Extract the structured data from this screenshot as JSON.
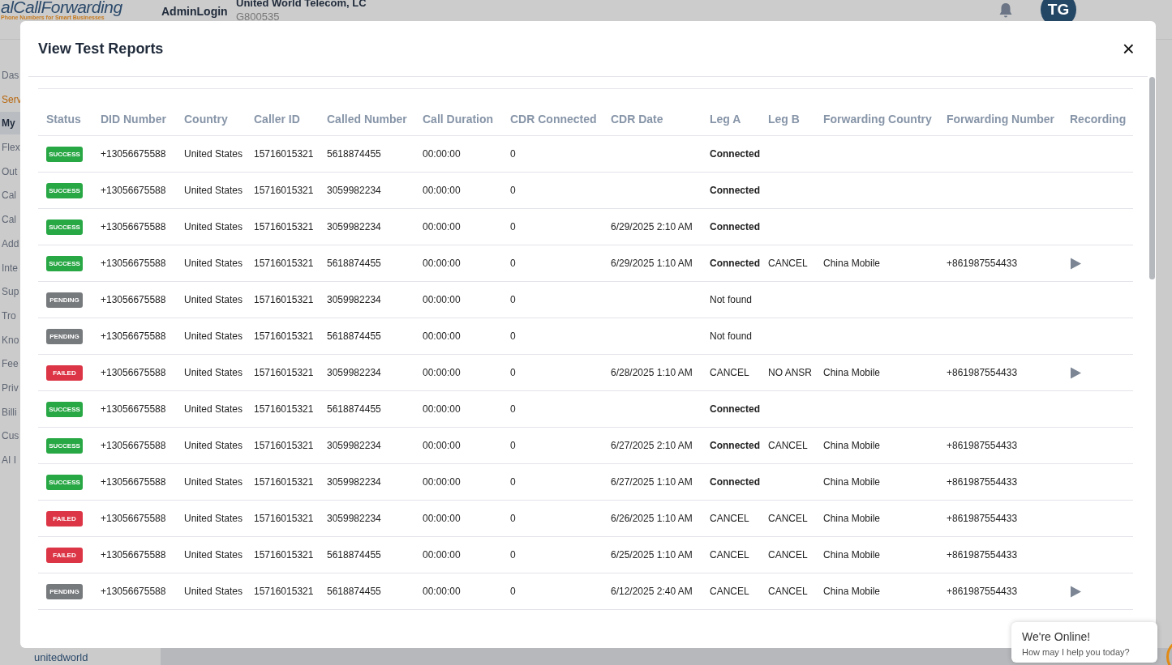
{
  "header": {
    "logo": "alCallForwarding",
    "tagline": "Phone Numbers for Smart Businesses",
    "user_label": "AdminLogin",
    "company": "United World Telecom, LC",
    "account": "G800535",
    "avatar": "TG"
  },
  "sidebar": {
    "items": [
      {
        "label": "Das",
        "kind": "item",
        "selected": false
      },
      {
        "label": "Serv",
        "kind": "section",
        "selected": false
      },
      {
        "label": "My",
        "kind": "item",
        "selected": true
      },
      {
        "label": "Flex",
        "kind": "item",
        "selected": false
      },
      {
        "label": "Out",
        "kind": "item",
        "selected": false
      },
      {
        "label": "Cal",
        "kind": "item",
        "selected": false
      },
      {
        "label": "Cal",
        "kind": "item",
        "selected": false
      },
      {
        "label": "Add",
        "kind": "item",
        "selected": false
      },
      {
        "label": "Inte",
        "kind": "item",
        "selected": false
      },
      {
        "label": "Sup",
        "kind": "item",
        "selected": false
      },
      {
        "label": "Tro",
        "kind": "item",
        "selected": false
      },
      {
        "label": "Kno",
        "kind": "item",
        "selected": false
      },
      {
        "label": "Fee",
        "kind": "item",
        "selected": false
      },
      {
        "label": "Priv",
        "kind": "item",
        "selected": false
      },
      {
        "label": "Billi",
        "kind": "item",
        "selected": false
      },
      {
        "label": "Cus",
        "kind": "item",
        "selected": false
      },
      {
        "label": "AI I",
        "kind": "item",
        "selected": false
      }
    ],
    "footer_logo": "unitedworld"
  },
  "modal": {
    "title": "View Test Reports",
    "close": "×",
    "table": {
      "columns": [
        "Status",
        "DID Number",
        "Country",
        "Caller ID",
        "Called Number",
        "Call Duration",
        "CDR Connected",
        "CDR Date",
        "Leg A",
        "Leg B",
        "Forwarding Country",
        "Forwarding Number",
        "Recording"
      ],
      "rows": [
        {
          "status": {
            "label": "SUCCESS",
            "kind": "success"
          },
          "did": "+13056675588",
          "country": "United States",
          "caller_id": "15716015321",
          "called": "5618874455",
          "duration": "00:00:00",
          "cdr_connected": "0",
          "cdr_date": "",
          "leg_a": {
            "text": "Connected",
            "emphasis": true
          },
          "leg_b": "",
          "fwd_country": "",
          "fwd_number": "",
          "recording": false
        },
        {
          "status": {
            "label": "SUCCESS",
            "kind": "success"
          },
          "did": "+13056675588",
          "country": "United States",
          "caller_id": "15716015321",
          "called": "3059982234",
          "duration": "00:00:00",
          "cdr_connected": "0",
          "cdr_date": "",
          "leg_a": {
            "text": "Connected",
            "emphasis": true
          },
          "leg_b": "",
          "fwd_country": "",
          "fwd_number": "",
          "recording": false
        },
        {
          "status": {
            "label": "SUCCESS",
            "kind": "success"
          },
          "did": "+13056675588",
          "country": "United States",
          "caller_id": "15716015321",
          "called": "3059982234",
          "duration": "00:00:00",
          "cdr_connected": "0",
          "cdr_date": "6/29/2025 2:10 AM",
          "leg_a": {
            "text": "Connected",
            "emphasis": true
          },
          "leg_b": "",
          "fwd_country": "",
          "fwd_number": "",
          "recording": false
        },
        {
          "status": {
            "label": "SUCCESS",
            "kind": "success"
          },
          "did": "+13056675588",
          "country": "United States",
          "caller_id": "15716015321",
          "called": "5618874455",
          "duration": "00:00:00",
          "cdr_connected": "0",
          "cdr_date": "6/29/2025 1:10 AM",
          "leg_a": {
            "text": "Connected",
            "emphasis": true
          },
          "leg_b": "CANCEL",
          "fwd_country": "China Mobile",
          "fwd_number": "+861987554433",
          "recording": true
        },
        {
          "status": {
            "label": "PENDING",
            "kind": "pending"
          },
          "did": "+13056675588",
          "country": "United States",
          "caller_id": "15716015321",
          "called": "3059982234",
          "duration": "00:00:00",
          "cdr_connected": "0",
          "cdr_date": "",
          "leg_a": {
            "text": "Not found",
            "emphasis": false
          },
          "leg_b": "",
          "fwd_country": "",
          "fwd_number": "",
          "recording": false
        },
        {
          "status": {
            "label": "PENDING",
            "kind": "pending"
          },
          "did": "+13056675588",
          "country": "United States",
          "caller_id": "15716015321",
          "called": "5618874455",
          "duration": "00:00:00",
          "cdr_connected": "0",
          "cdr_date": "",
          "leg_a": {
            "text": "Not found",
            "emphasis": false
          },
          "leg_b": "",
          "fwd_country": "",
          "fwd_number": "",
          "recording": false
        },
        {
          "status": {
            "label": "FAILED",
            "kind": "failed"
          },
          "did": "+13056675588",
          "country": "United States",
          "caller_id": "15716015321",
          "called": "3059982234",
          "duration": "00:00:00",
          "cdr_connected": "0",
          "cdr_date": "6/28/2025 1:10 AM",
          "leg_a": {
            "text": "CANCEL",
            "emphasis": false
          },
          "leg_b": "NO ANSR",
          "fwd_country": "China Mobile",
          "fwd_number": "+861987554433",
          "recording": true
        },
        {
          "status": {
            "label": "SUCCESS",
            "kind": "success"
          },
          "did": "+13056675588",
          "country": "United States",
          "caller_id": "15716015321",
          "called": "5618874455",
          "duration": "00:00:00",
          "cdr_connected": "0",
          "cdr_date": "",
          "leg_a": {
            "text": "Connected",
            "emphasis": true
          },
          "leg_b": "",
          "fwd_country": "",
          "fwd_number": "",
          "recording": false
        },
        {
          "status": {
            "label": "SUCCESS",
            "kind": "success"
          },
          "did": "+13056675588",
          "country": "United States",
          "caller_id": "15716015321",
          "called": "3059982234",
          "duration": "00:00:00",
          "cdr_connected": "0",
          "cdr_date": "6/27/2025 2:10 AM",
          "leg_a": {
            "text": "Connected",
            "emphasis": true
          },
          "leg_b": "CANCEL",
          "fwd_country": "China Mobile",
          "fwd_number": "+861987554433",
          "recording": false
        },
        {
          "status": {
            "label": "SUCCESS",
            "kind": "success"
          },
          "did": "+13056675588",
          "country": "United States",
          "caller_id": "15716015321",
          "called": "3059982234",
          "duration": "00:00:00",
          "cdr_connected": "0",
          "cdr_date": "6/27/2025 1:10 AM",
          "leg_a": {
            "text": "Connected",
            "emphasis": true
          },
          "leg_b": "",
          "fwd_country": "China Mobile",
          "fwd_number": "+861987554433",
          "recording": false
        },
        {
          "status": {
            "label": "FAILED",
            "kind": "failed"
          },
          "did": "+13056675588",
          "country": "United States",
          "caller_id": "15716015321",
          "called": "3059982234",
          "duration": "00:00:00",
          "cdr_connected": "0",
          "cdr_date": "6/26/2025 1:10 AM",
          "leg_a": {
            "text": "CANCEL",
            "emphasis": false
          },
          "leg_b": "CANCEL",
          "fwd_country": "China Mobile",
          "fwd_number": "+861987554433",
          "recording": false
        },
        {
          "status": {
            "label": "FAILED",
            "kind": "failed"
          },
          "did": "+13056675588",
          "country": "United States",
          "caller_id": "15716015321",
          "called": "5618874455",
          "duration": "00:00:00",
          "cdr_connected": "0",
          "cdr_date": "6/25/2025 1:10 AM",
          "leg_a": {
            "text": "CANCEL",
            "emphasis": false
          },
          "leg_b": "CANCEL",
          "fwd_country": "China Mobile",
          "fwd_number": "+861987554433",
          "recording": false
        },
        {
          "status": {
            "label": "PENDING",
            "kind": "pending"
          },
          "did": "+13056675588",
          "country": "United States",
          "caller_id": "15716015321",
          "called": "5618874455",
          "duration": "00:00:00",
          "cdr_connected": "0",
          "cdr_date": "6/12/2025 2:40 AM",
          "leg_a": {
            "text": "CANCEL",
            "emphasis": false
          },
          "leg_b": "CANCEL",
          "fwd_country": "China Mobile",
          "fwd_number": "+861987554433",
          "recording": true
        }
      ]
    }
  },
  "chat": {
    "title": "We're Online!",
    "subtitle": "How may I help you today?"
  }
}
